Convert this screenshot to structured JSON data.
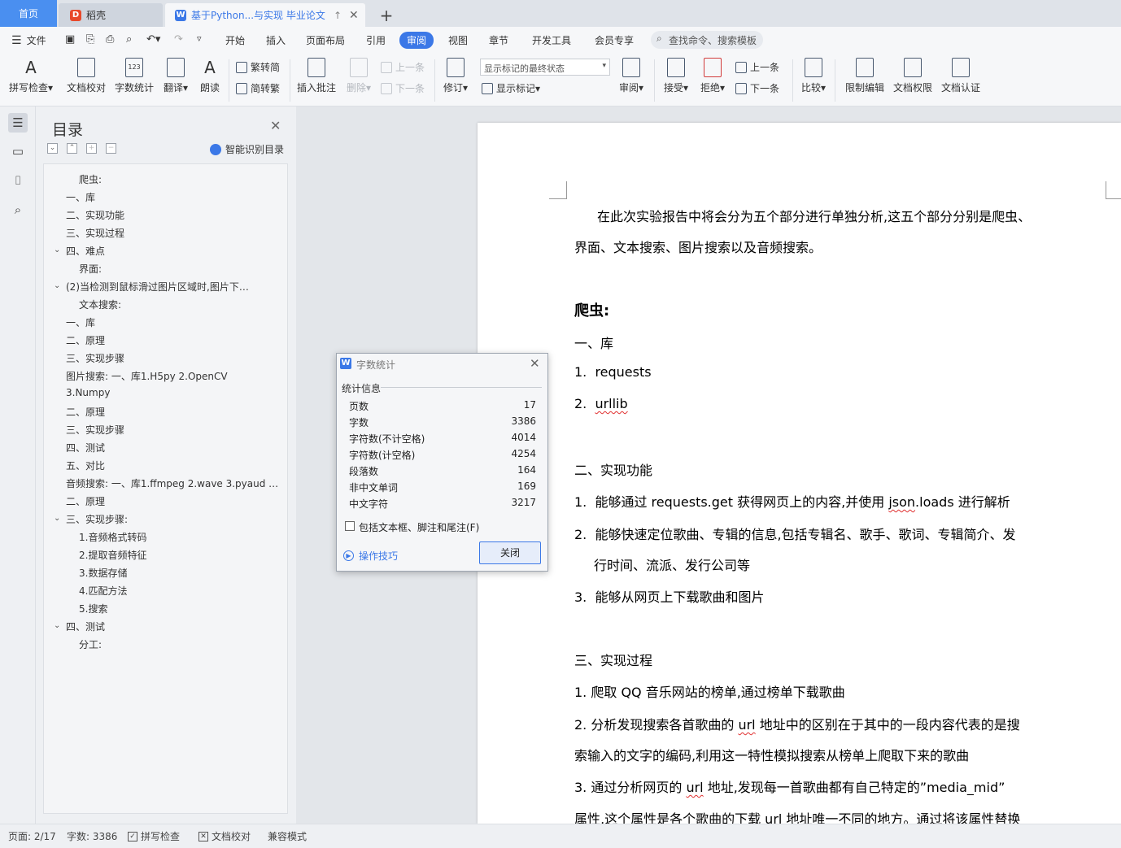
{
  "tabs": {
    "home": "首页",
    "daoke": "稻壳",
    "doc": "基于Python...与实现 毕业论文"
  },
  "menu": {
    "file": "文件",
    "items": [
      "开始",
      "插入",
      "页面布局",
      "引用",
      "审阅",
      "视图",
      "章节",
      "开发工具",
      "会员专享"
    ],
    "search_placeholder": "查找命令、搜索模板"
  },
  "ribbon": {
    "spell": "拼写检查",
    "proof": "文档校对",
    "wordcount": "字数统计",
    "translate": "翻译",
    "read": "朗读",
    "trad_to_simp": "繁转简",
    "simp_to_trad": "简转繁",
    "insert_comment": "插入批注",
    "delete": "删除",
    "prev": "上一条",
    "next": "下一条",
    "revise": "修订",
    "mark_select": "显示标记的最终状态",
    "show_marks": "显示标记",
    "review": "审阅",
    "accept": "接受",
    "reject": "拒绝",
    "prev2": "上一条",
    "next2": "下一条",
    "compare": "比较",
    "restrict": "限制编辑",
    "permissions": "文档权限",
    "certify": "文档认证"
  },
  "toc": {
    "title": "目录",
    "ai_label": "智能识别目录",
    "items": [
      {
        "text": "爬虫:",
        "indent": 2,
        "caret": false
      },
      {
        "text": "一、库",
        "indent": 1,
        "caret": false
      },
      {
        "text": "二、实现功能",
        "indent": 1,
        "caret": false
      },
      {
        "text": "三、实现过程",
        "indent": 1,
        "caret": false
      },
      {
        "text": "四、难点",
        "indent": 1,
        "caret": true
      },
      {
        "text": "界面:",
        "indent": 2,
        "caret": false
      },
      {
        "text": "(2)当检测到鼠标滑过图片区域时,图片下…",
        "indent": 1,
        "caret": true
      },
      {
        "text": "文本搜索:",
        "indent": 2,
        "caret": false
      },
      {
        "text": "一、库",
        "indent": 1,
        "caret": false
      },
      {
        "text": "二、原理",
        "indent": 1,
        "caret": false
      },
      {
        "text": "三、实现步骤",
        "indent": 1,
        "caret": false
      },
      {
        "text": "图片搜索: 一、库1.H5py 2.OpenCV",
        "indent": 1,
        "caret": false
      },
      {
        "text": "3.Numpy",
        "indent": 1,
        "caret": false
      },
      {
        "text": "二、原理",
        "indent": 1,
        "caret": false
      },
      {
        "text": "三、实现步骤",
        "indent": 1,
        "caret": false
      },
      {
        "text": "四、测试",
        "indent": 1,
        "caret": false
      },
      {
        "text": "五、对比",
        "indent": 1,
        "caret": false
      },
      {
        "text": "音频搜索: 一、库1.ffmpeg 2.wave 3.pyaud …",
        "indent": 1,
        "caret": false
      },
      {
        "text": "二、原理",
        "indent": 1,
        "caret": false
      },
      {
        "text": "三、实现步骤:",
        "indent": 1,
        "caret": true
      },
      {
        "text": "1.音频格式转码",
        "indent": 2,
        "caret": false
      },
      {
        "text": "2.提取音频特征",
        "indent": 2,
        "caret": false
      },
      {
        "text": "3.数据存储",
        "indent": 2,
        "caret": false
      },
      {
        "text": "4.匹配方法",
        "indent": 2,
        "caret": false
      },
      {
        "text": "5.搜索",
        "indent": 2,
        "caret": false
      },
      {
        "text": "四、测试",
        "indent": 1,
        "caret": true
      },
      {
        "text": "分工:",
        "indent": 2,
        "caret": false
      }
    ]
  },
  "doc": {
    "intro1": "在此次实验报告中将会分为五个部分进行单独分析,这五个部分分别是爬虫、",
    "intro2": "界面、文本搜索、图片搜索以及音频搜索。",
    "h_crawler": "爬虫:",
    "lib": "一、库",
    "lib1_num": "1.",
    "lib1": "requests",
    "lib2_num": "2.",
    "lib2": "urllib",
    "func": "二、实现功能",
    "f1_num": "1.",
    "f1_a": "能够通过 requests.get 获得网页上的内容,并使用 ",
    "f1_b": "json",
    "f1_c": ".loads 进行解析",
    "f2_num": "2.",
    "f2_a": "能够快速定位歌曲、专辑的信息,包括专辑名、歌手、歌词、专辑简介、发",
    "f2_b": "行时间、流派、发行公司等",
    "f3_num": "3.",
    "f3": "能够从网页上下载歌曲和图片",
    "proc": "三、实现过程",
    "p1": "1. 爬取 QQ 音乐网站的榜单,通过榜单下载歌曲",
    "p2_a": "2. 分析发现搜索各首歌曲的 ",
    "p2_url": "url",
    "p2_b": " 地址中的区别在于其中的一段内容代表的是搜",
    "p2_c": "索输入的文字的编码,利用这一特性模拟搜索从榜单上爬取下来的歌曲",
    "p3_a": "3. 通过分析网页的 ",
    "p3_url": "url",
    "p3_b": " 地址,发现每一首歌曲都有自己特定的”media_mid”",
    "p3_c": "属性,这个属性是各个歌曲的下载 url 地址唯一不同的地方。通过将该属性替换"
  },
  "dialog": {
    "title": "字数统计",
    "section": "统计信息",
    "stats": [
      {
        "label": "页数",
        "value": "17"
      },
      {
        "label": "字数",
        "value": "3386"
      },
      {
        "label": "字符数(不计空格)",
        "value": "4014"
      },
      {
        "label": "字符数(计空格)",
        "value": "4254"
      },
      {
        "label": "段落数",
        "value": "164"
      },
      {
        "label": "非中文单词",
        "value": "169"
      },
      {
        "label": "中文字符",
        "value": "3217"
      }
    ],
    "include_label": "包括文本框、脚注和尾注(F)",
    "tips": "操作技巧",
    "close_button": "关闭"
  },
  "status": {
    "page": "页面: 2/17",
    "words": "字数: 3386",
    "spell": "拼写检查",
    "proof": "文档校对",
    "compat": "兼容模式"
  },
  "colors": {
    "accent": "#3b78e7",
    "home_tab": "#4a8ff0",
    "daoke_logo": "#e8492b"
  }
}
